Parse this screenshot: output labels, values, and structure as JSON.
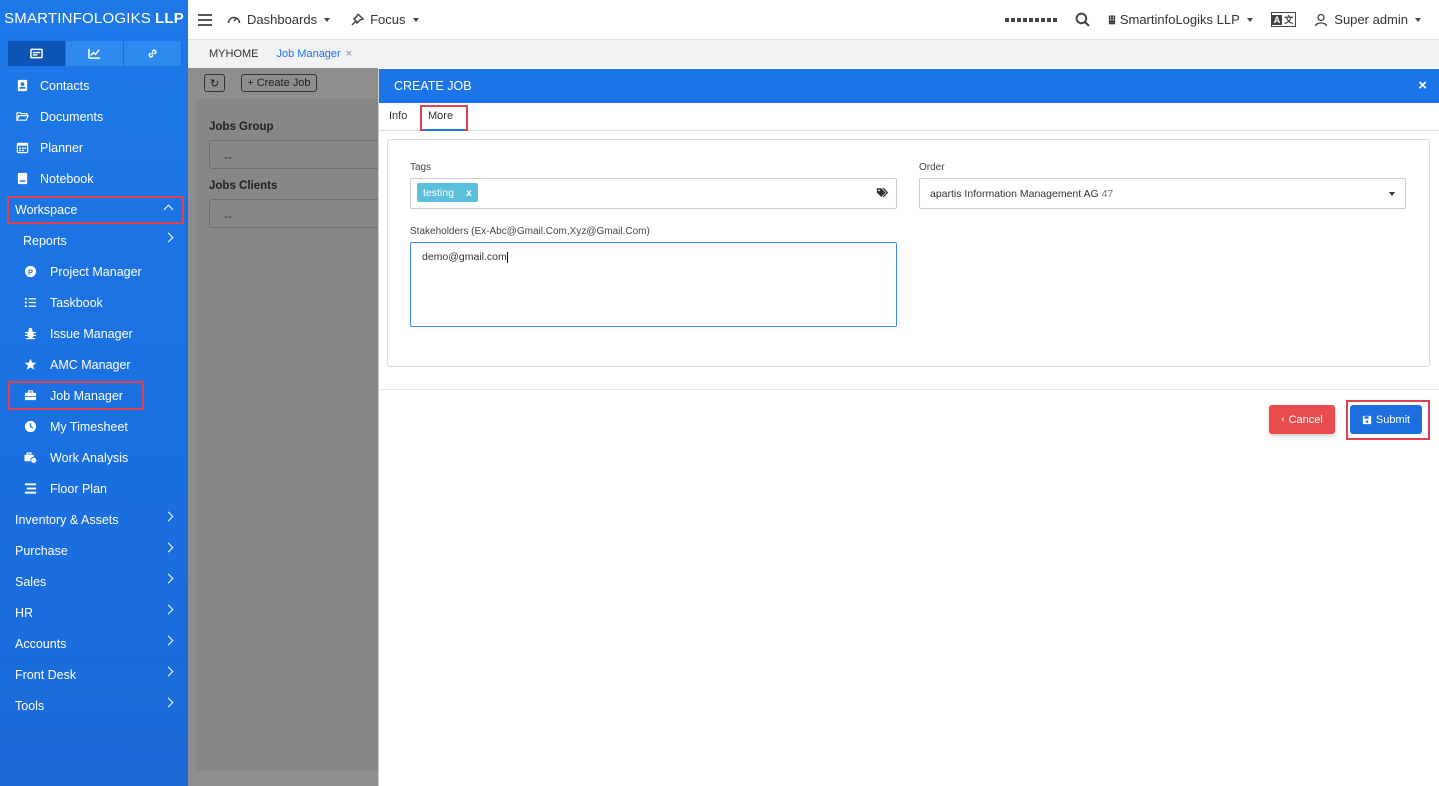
{
  "brand": {
    "name": "SMARTINFOLOGIKS",
    "suffix": "LLP"
  },
  "sidebar": {
    "items": [
      {
        "label": "Contacts"
      },
      {
        "label": "Documents"
      },
      {
        "label": "Planner"
      },
      {
        "label": "Notebook"
      },
      {
        "label": "Workspace"
      },
      {
        "label": "Reports"
      },
      {
        "label": "Project Manager"
      },
      {
        "label": "Taskbook"
      },
      {
        "label": "Issue Manager"
      },
      {
        "label": "AMC Manager"
      },
      {
        "label": "Job Manager"
      },
      {
        "label": "My Timesheet"
      },
      {
        "label": "Work Analysis"
      },
      {
        "label": "Floor Plan"
      },
      {
        "label": "Inventory & Assets"
      },
      {
        "label": "Purchase"
      },
      {
        "label": "Sales"
      },
      {
        "label": "HR"
      },
      {
        "label": "Accounts"
      },
      {
        "label": "Front Desk"
      },
      {
        "label": "Tools"
      }
    ]
  },
  "topbar": {
    "dashboards": "Dashboards",
    "focus": "Focus",
    "company": "SmartinfoLogiks LLP",
    "user": "Super admin"
  },
  "breadcrumb": {
    "home": "MYHOME",
    "current": "Job Manager",
    "close": "×"
  },
  "background": {
    "refresh": "↻",
    "create_job": "+ Create Job",
    "jobs_group_label": "Jobs Group",
    "jobs_group_value": "--",
    "jobs_clients_label": "Jobs Clients",
    "jobs_clients_value": "--"
  },
  "modal": {
    "title": "CREATE JOB",
    "close": "×",
    "tabs": {
      "info": "Info",
      "more": "More"
    },
    "tags_label": "Tags",
    "tag_value": "testing",
    "tag_remove": "x",
    "order_label": "Order",
    "order_value": "apartis Information Management AG",
    "order_num": "47",
    "stakeholders_label": "Stakeholders (Ex-Abc@Gmail.Com,Xyz@Gmail.Com)",
    "stakeholders_value": "demo@gmail.com",
    "cancel": "Cancel",
    "submit": "Submit"
  }
}
